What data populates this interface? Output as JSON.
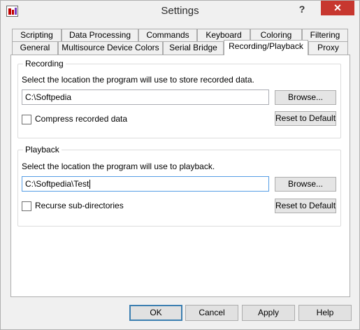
{
  "window": {
    "title": "Settings",
    "help_glyph": "?",
    "close_glyph": "✕"
  },
  "tabs": {
    "row1": [
      "Scripting",
      "Data Processing",
      "Commands",
      "Keyboard",
      "Coloring",
      "Filtering"
    ],
    "row2": [
      "General",
      "Multisource Device Colors",
      "Serial Bridge",
      "Recording/Playback",
      "Proxy"
    ],
    "active": "Recording/Playback"
  },
  "recording": {
    "title": "Recording",
    "description": "Select the location the program will use to store recorded data.",
    "path_value": "C:\\Softpedia",
    "browse_label": "Browse...",
    "checkbox_label": "Compress recorded data",
    "checkbox_checked": false,
    "reset_label": "Reset to Default"
  },
  "playback": {
    "title": "Playback",
    "description": "Select the location the program will use to playback.",
    "path_value": "C:\\Softpedia\\Test",
    "browse_label": "Browse...",
    "checkbox_label": "Recurse sub-directories",
    "checkbox_checked": false,
    "reset_label": "Reset to Default"
  },
  "footer": {
    "ok_label": "OK",
    "cancel_label": "Cancel",
    "apply_label": "Apply",
    "help_label": "Help"
  },
  "colors": {
    "close_button": "#c7372f",
    "focus_border": "#569de5",
    "default_button_border": "#3c7fb1"
  },
  "icons": {
    "app": "bar-chart-icon",
    "help": "question-mark-icon",
    "close": "close-icon"
  }
}
